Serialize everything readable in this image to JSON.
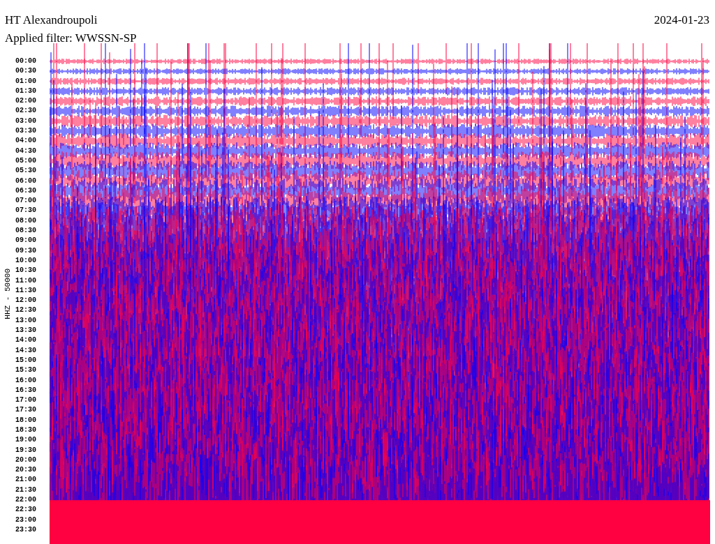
{
  "header": {
    "station": "HT Alexandroupoli",
    "filter": "Applied filter: WWSSN-SP",
    "date": "2024-01-23"
  },
  "axis_label": "HHZ - 50000",
  "time_labels": [
    "00:00",
    "00:30",
    "01:00",
    "01:30",
    "02:00",
    "02:30",
    "03:00",
    "03:30",
    "04:00",
    "04:30",
    "05:00",
    "05:30",
    "06:00",
    "06:30",
    "07:00",
    "07:30",
    "08:00",
    "08:30",
    "09:00",
    "09:30",
    "10:00",
    "10:30",
    "11:00",
    "11:30",
    "12:00",
    "12:30",
    "13:00",
    "13:30",
    "14:00",
    "14:30",
    "15:00",
    "15:30",
    "16:00",
    "16:30",
    "17:00",
    "17:30",
    "18:00",
    "18:30",
    "19:00",
    "19:30",
    "20:00",
    "20:30",
    "21:00",
    "21:30",
    "22:00",
    "22:30",
    "23:00",
    "23:30"
  ]
}
